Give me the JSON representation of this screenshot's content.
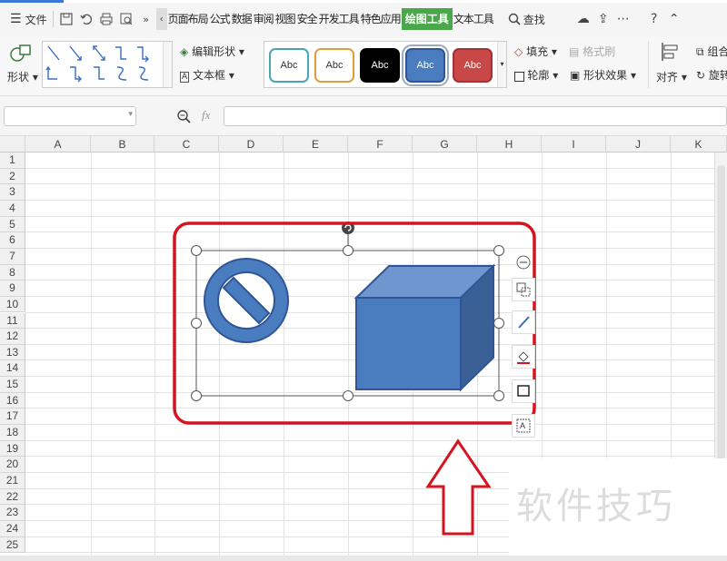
{
  "menubar": {
    "menu_label": "文件",
    "tabs": [
      "页面布局",
      "公式",
      "数据",
      "审阅",
      "视图",
      "安全",
      "开发工具",
      "特色应用",
      "绘图工具",
      "文本工具"
    ],
    "active_tab": "绘图工具",
    "search_label": "查找"
  },
  "ribbon": {
    "shapes_label": "形状",
    "edit_shape_label": "编辑形状",
    "textbox_label": "文本框",
    "style_samples": [
      {
        "label": "Abc",
        "border": "#4aa6b0",
        "fill": "#ffffff",
        "text": "#333333"
      },
      {
        "label": "Abc",
        "border": "#e39c3c",
        "fill": "#ffffff",
        "text": "#333333"
      },
      {
        "label": "Abc",
        "border": "#000000",
        "fill": "#000000",
        "text": "#ffffff"
      },
      {
        "label": "Abc",
        "border": "#2f5597",
        "fill": "#4a7dbf",
        "text": "#ffffff"
      },
      {
        "label": "Abc",
        "border": "#a33232",
        "fill": "#c84848",
        "text": "#ffffff"
      }
    ],
    "fill_label": "填充",
    "format_painter_label": "格式刷",
    "outline_label": "轮廓",
    "shape_effects_label": "形状效果",
    "align_label": "对齐",
    "group_label": "组合",
    "rotate_label": "旋转"
  },
  "formula_bar": {
    "fx_label": "fx",
    "name_box_value": "",
    "formula_value": ""
  },
  "sheet": {
    "columns": [
      "A",
      "B",
      "C",
      "D",
      "E",
      "F",
      "G",
      "H",
      "I",
      "J",
      "K"
    ],
    "rows": [
      "1",
      "2",
      "3",
      "4",
      "5",
      "6",
      "7",
      "8",
      "9",
      "10",
      "11",
      "12",
      "13",
      "14",
      "15",
      "16",
      "17",
      "18",
      "19",
      "20",
      "21",
      "22",
      "23",
      "24",
      "25"
    ]
  },
  "colors": {
    "shape_fill": "#4a7dbf",
    "shape_stroke": "#2f5597",
    "highlight_red": "#d4141e",
    "active_tab_green": "#4aa84a"
  },
  "watermark": "软件技巧"
}
